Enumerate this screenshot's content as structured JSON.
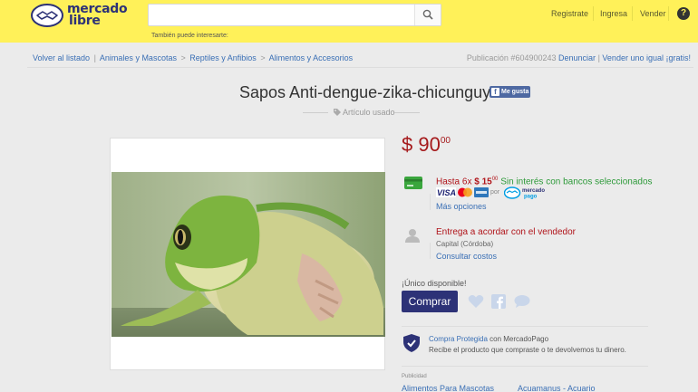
{
  "header": {
    "logo_text_line1": "mercado",
    "logo_text_line2": "libre",
    "search_placeholder": "",
    "suggest_text": "También puede interesarte:",
    "nav": [
      "Registrate",
      "Ingresa",
      "Vender"
    ],
    "help": "?"
  },
  "breadcrumb": {
    "back": "Volver al listado",
    "crumbs": [
      "Animales y Mascotas",
      "Reptiles y Anfibios",
      "Alimentos y Accesorios"
    ],
    "publication": "Publicación #604900243",
    "report": "Denunciar",
    "sell_same": "Vender uno igual ¡gratis!"
  },
  "product": {
    "title": "Sapos Anti-dengue-zika-chicunguya",
    "like_label": "Me gusta",
    "condition": "Artículo usado",
    "price_symbol": "$",
    "price_int": "90",
    "price_cents": "00"
  },
  "payment": {
    "hasta": "Hasta 6x",
    "cuota_int": "$ 15",
    "cuota_cents": "00",
    "sin_interes": "Sin interés con bancos seleccionados",
    "por": "por",
    "mp_line1": "mercado",
    "mp_line2": "pago",
    "more_methods": "Más opciones"
  },
  "shipping": {
    "title": "Entrega a acordar con el vendedor",
    "location": "Capital (Córdoba)",
    "costs_link": "Consultar costos"
  },
  "purchase": {
    "stock": "¡Único disponible!",
    "buy_label": "Comprar"
  },
  "protection": {
    "link": "Compra Protegida",
    "with": " con MercadoPago",
    "desc": "Recibe el producto que compraste o te devolvemos tu dinero."
  },
  "ads": {
    "label": "Publicidad",
    "links": [
      "Alimentos Para Mascotas",
      "Acuamanus - Acuario"
    ]
  },
  "colors": {
    "header_bg": "#fff159",
    "brand_blue": "#2d3277",
    "price_red": "#a5191b",
    "link_blue": "#3a6fb5",
    "green": "#2e9a3a"
  }
}
